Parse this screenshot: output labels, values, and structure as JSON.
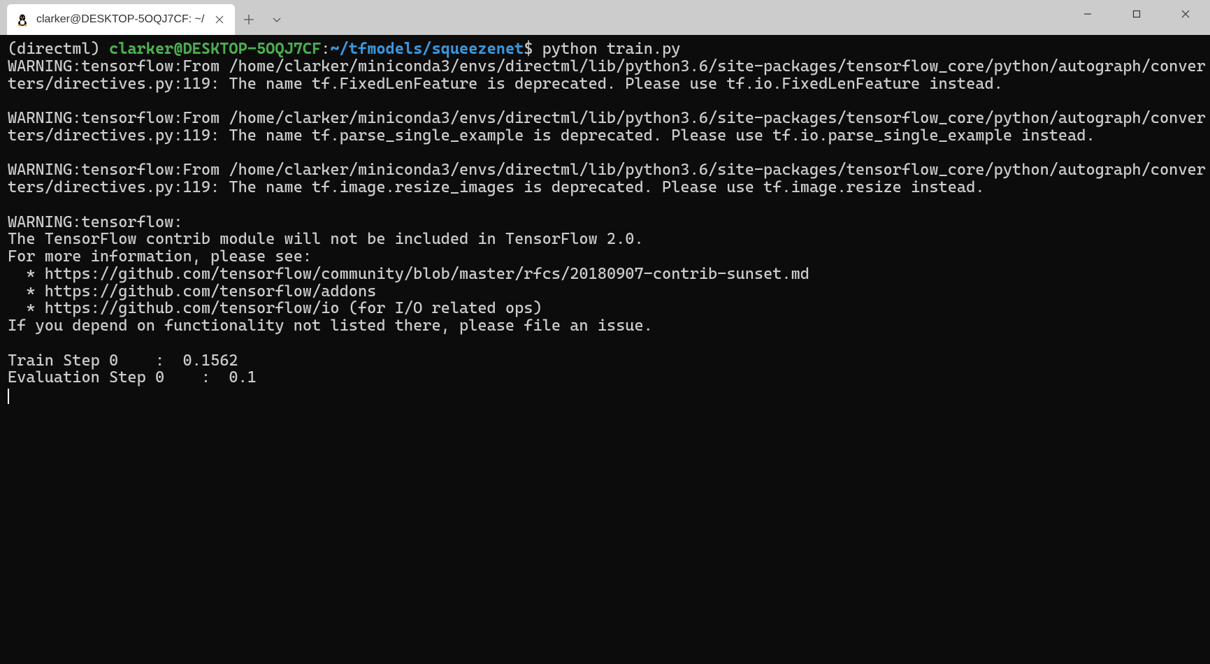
{
  "tab": {
    "title": "clarker@DESKTOP-5OQJ7CF: ~/",
    "icon_name": "tux-icon"
  },
  "prompt": {
    "env": "(directml) ",
    "userhost": "clarker@DESKTOP-5OQJ7CF",
    "colon": ":",
    "cwd": "~/tfmodels/squeezenet",
    "dollar": "$",
    "command": " python train.py"
  },
  "output_lines": [
    "WARNING:tensorflow:From /home/clarker/miniconda3/envs/directml/lib/python3.6/site-packages/tensorflow_core/python/autograph/converters/directives.py:119: The name tf.FixedLenFeature is deprecated. Please use tf.io.FixedLenFeature instead.",
    "",
    "WARNING:tensorflow:From /home/clarker/miniconda3/envs/directml/lib/python3.6/site-packages/tensorflow_core/python/autograph/converters/directives.py:119: The name tf.parse_single_example is deprecated. Please use tf.io.parse_single_example instead.",
    "",
    "WARNING:tensorflow:From /home/clarker/miniconda3/envs/directml/lib/python3.6/site-packages/tensorflow_core/python/autograph/converters/directives.py:119: The name tf.image.resize_images is deprecated. Please use tf.image.resize instead.",
    "",
    "WARNING:tensorflow:",
    "The TensorFlow contrib module will not be included in TensorFlow 2.0.",
    "For more information, please see:",
    "  * https://github.com/tensorflow/community/blob/master/rfcs/20180907-contrib-sunset.md",
    "  * https://github.com/tensorflow/addons",
    "  * https://github.com/tensorflow/io (for I/O related ops)",
    "If you depend on functionality not listed there, please file an issue.",
    "",
    "Train Step 0    :  0.1562",
    "Evaluation Step 0    :  0.1"
  ]
}
